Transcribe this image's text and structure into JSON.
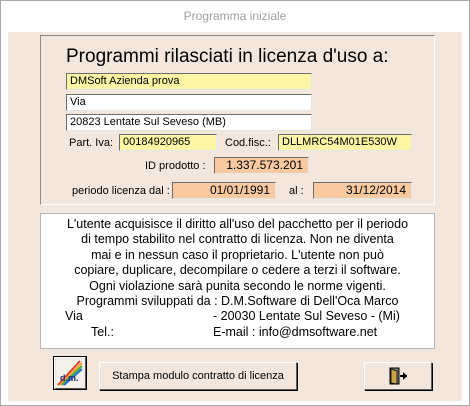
{
  "window": {
    "title": "Programma iniziale"
  },
  "panel": {
    "heading": "Programmi rilasciati in licenza d'uso a:",
    "company": "DMSoft Azienda prova",
    "address": "Via",
    "city": "20823 Lentate Sul Seveso (MB)",
    "piva_label": "Part. Iva:",
    "piva_value": "00184920965",
    "codfisc_label": "Cod.fisc.:",
    "codfisc_value": "DLLMRC54M01E530W",
    "id_label": "ID prodotto :",
    "id_value": "1.337.573.201",
    "period_label": "periodo licenza dal :",
    "period_from": "01/01/1991",
    "period_to_label": "al :",
    "period_to": "31/12/2014"
  },
  "license": {
    "lines": [
      "L'utente acquisisce il diritto all'uso del pacchetto per il periodo",
      "di tempo stabilito nel contratto di licenza.  Non ne diventa",
      "mai e in nessun caso il proprietario. L'utente non può",
      "copiare, duplicare, decompilare o cedere a terzi il software.",
      "Ogni violazione sarà punita secondo le norme vigenti.",
      "Programmi sviluppati da : D.M.Software di Dell'Oca Marco"
    ],
    "addr_via": "Via",
    "addr_rest": "- 20030 Lentate Sul Seveso - (Mi)",
    "tel_label": "Tel.:",
    "email": "E-mail : info@dmsoftware.net"
  },
  "buttons": {
    "logo_text": "d.m.",
    "print_label": "Stampa modulo contratto di licenza"
  },
  "colors": {
    "background": "#f3e7dd",
    "yellow_field": "#fcf6a4",
    "orange_field": "#f9c9a1"
  },
  "icons": {
    "logo": "dmsoft-logo-icon",
    "exit": "exit-door-icon"
  }
}
